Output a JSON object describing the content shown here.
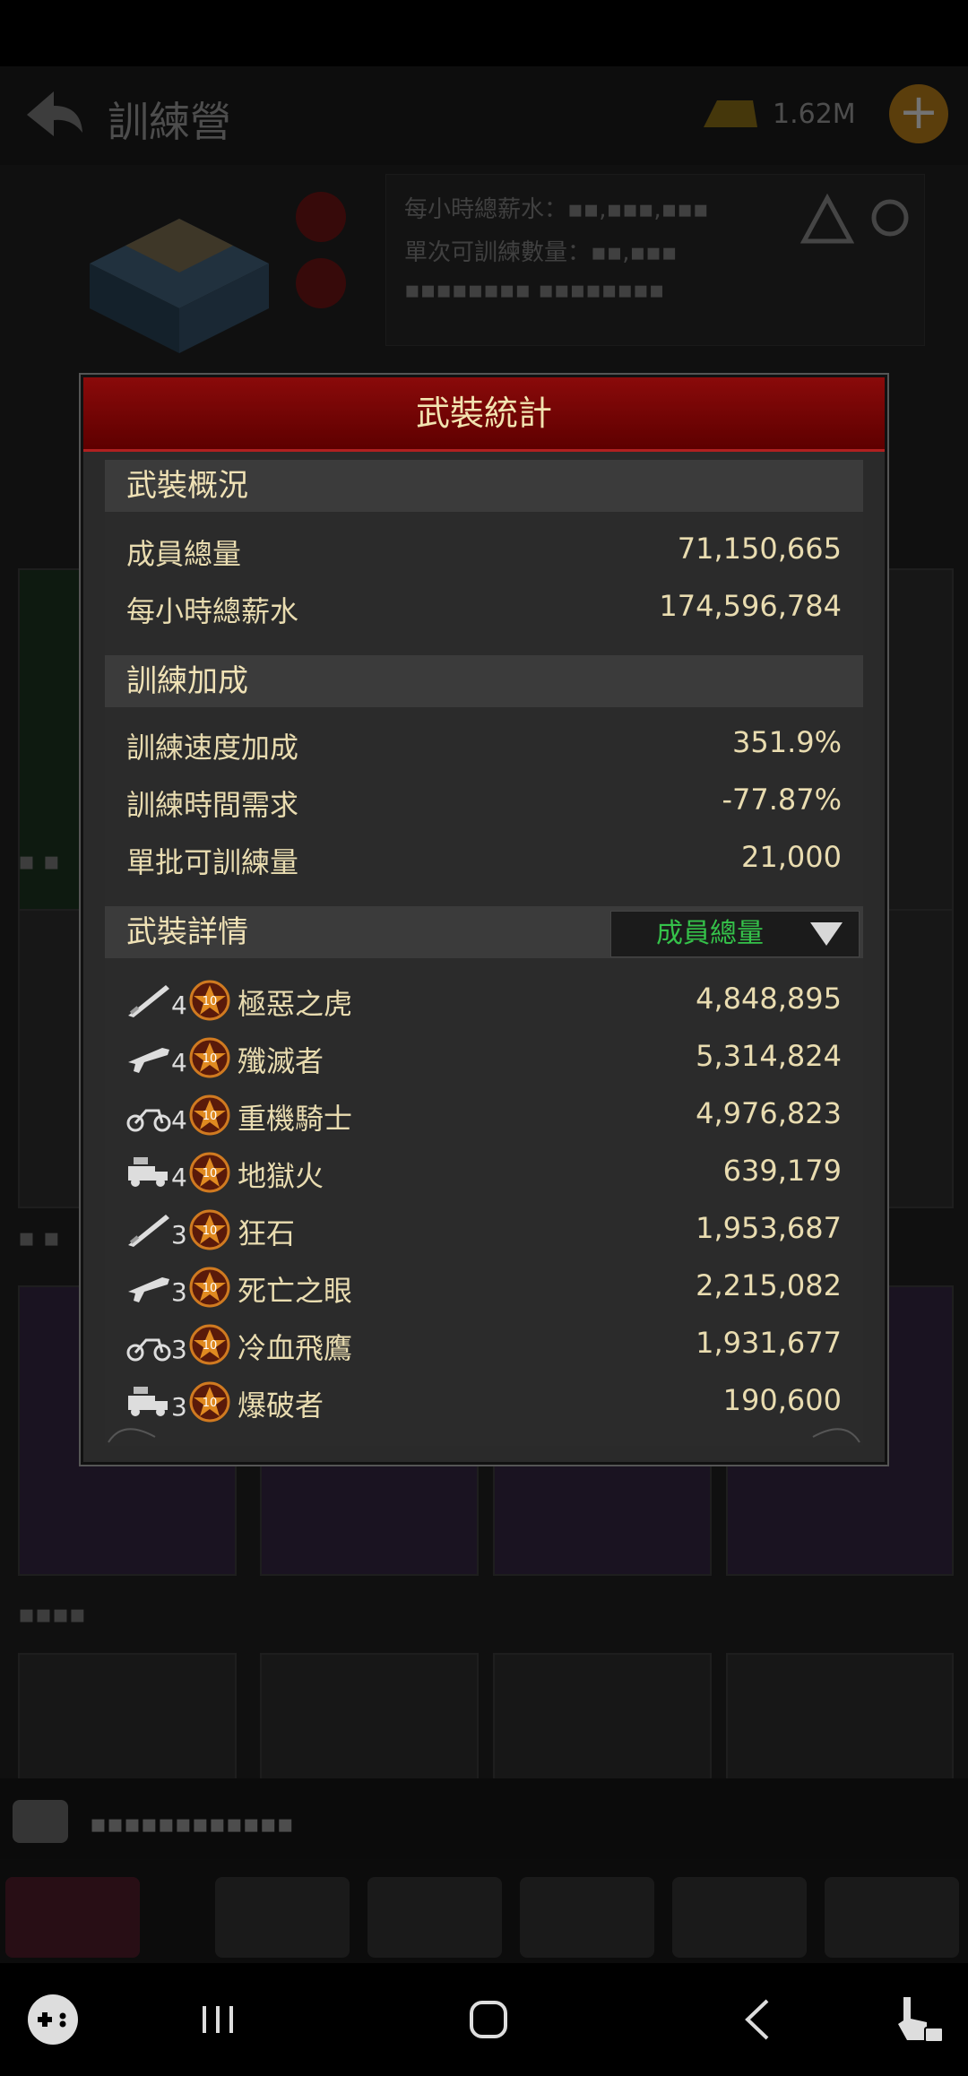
{
  "background": {
    "screen_title": "訓練營",
    "gold_amount": "1.62M",
    "info_lines": [
      "每小時總薪水：▪▪,▪▪▪,▪▪▪",
      "單次可訓練數量：▪▪,▪▪▪",
      "▪▪▪▪▪▪▪▪ ▪▪▪▪▪▪▪▪"
    ],
    "chat_text": "▪▪▪▪▪▪▪▪▪▪▪▪"
  },
  "modal": {
    "title": "武裝統計",
    "overview": {
      "title": "武裝概況",
      "rows": [
        {
          "label": "成員總量",
          "value": "71,150,665"
        },
        {
          "label": "每小時總薪水",
          "value": "174,596,784"
        }
      ]
    },
    "training": {
      "title": "訓練加成",
      "rows": [
        {
          "label": "訓練速度加成",
          "value": "351.9%"
        },
        {
          "label": "訓練時間需求",
          "value": "-77.87%"
        },
        {
          "label": "單批可訓練量",
          "value": "21,000"
        }
      ]
    },
    "details": {
      "title": "武裝詳情",
      "sort_selected": "成員總量",
      "units": [
        {
          "icon": "blade-icon",
          "tier": "4",
          "name": "極惡之虎",
          "value": "4,848,895"
        },
        {
          "icon": "rifle-icon",
          "tier": "4",
          "name": "殲滅者",
          "value": "5,314,824"
        },
        {
          "icon": "motorcycle-icon",
          "tier": "4",
          "name": "重機騎士",
          "value": "4,976,823"
        },
        {
          "icon": "truck-icon",
          "tier": "4",
          "name": "地獄火",
          "value": "639,179"
        },
        {
          "icon": "blade-icon",
          "tier": "3",
          "name": "狂石",
          "value": "1,953,687"
        },
        {
          "icon": "rifle-icon",
          "tier": "3",
          "name": "死亡之眼",
          "value": "2,215,082"
        },
        {
          "icon": "motorcycle-icon",
          "tier": "3",
          "name": "冷血飛鷹",
          "value": "1,931,677"
        },
        {
          "icon": "truck-icon",
          "tier": "3",
          "name": "爆破者",
          "value": "190,600"
        }
      ],
      "rank_badge_text": "10"
    }
  },
  "colors": {
    "header_red": "#6e0404",
    "text_cream": "#e9dcb0",
    "dropdown_green": "#35c24a"
  }
}
